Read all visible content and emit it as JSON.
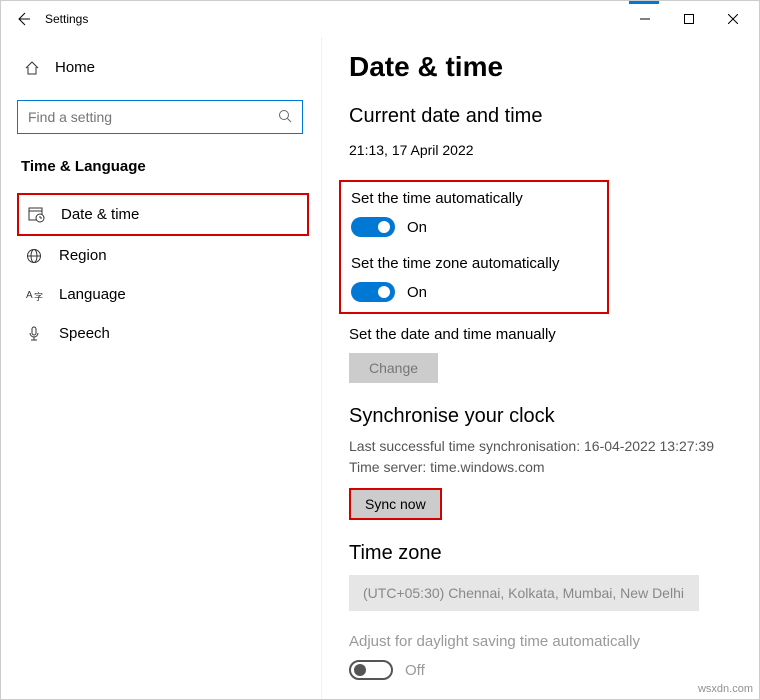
{
  "titlebar": {
    "title": "Settings"
  },
  "sidebar": {
    "home": "Home",
    "search_placeholder": "Find a setting",
    "category": "Time & Language",
    "items": [
      {
        "label": "Date & time"
      },
      {
        "label": "Region"
      },
      {
        "label": "Language"
      },
      {
        "label": "Speech"
      }
    ]
  },
  "content": {
    "heading": "Date & time",
    "subheading": "Current date and time",
    "current_datetime": "21:13, 17 April 2022",
    "auto_time": {
      "label": "Set the time automatically",
      "state": "On"
    },
    "auto_zone": {
      "label": "Set the time zone automatically",
      "state": "On"
    },
    "manual": {
      "label": "Set the date and time manually",
      "button": "Change"
    },
    "sync": {
      "heading": "Synchronise your clock",
      "last": "Last successful time synchronisation: 16-04-2022 13:27:39",
      "server": "Time server: time.windows.com",
      "button": "Sync now"
    },
    "timezone": {
      "heading": "Time zone",
      "value": "(UTC+05:30) Chennai, Kolkata, Mumbai, New Delhi"
    },
    "dst": {
      "label": "Adjust for daylight saving time automatically",
      "state": "Off"
    }
  },
  "watermark": "wsxdn.com"
}
